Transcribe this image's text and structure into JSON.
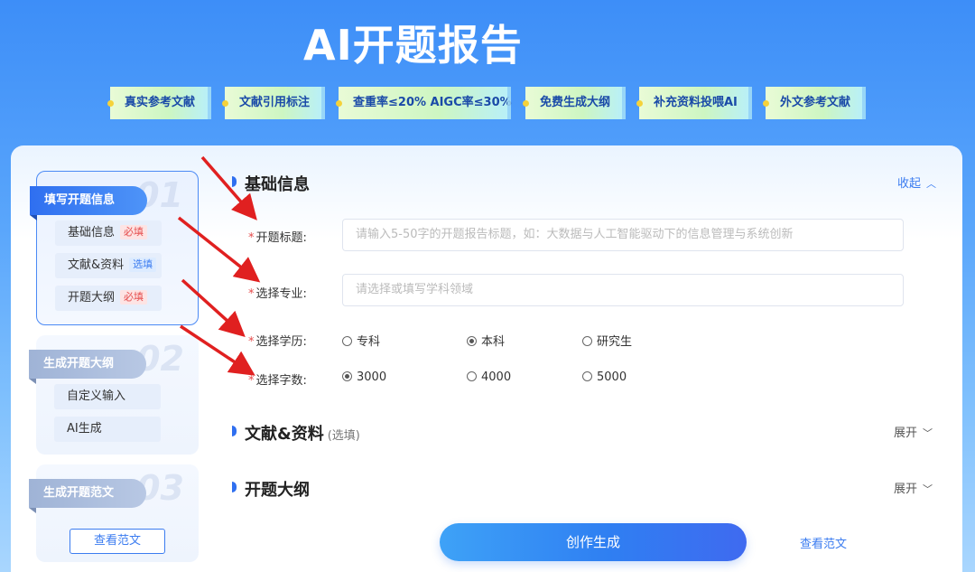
{
  "banner": {
    "title": "AI开题报告",
    "tags": [
      "真实参考文献",
      "文献引用标注",
      "查重率≤20%  AIGC率≤30%",
      "免费生成大纲",
      "补充资料投喂AI",
      "外文参考文献"
    ]
  },
  "sidebar": {
    "steps": [
      {
        "num": "01",
        "label": "填写开题信息",
        "items": [
          {
            "label": "基础信息",
            "tag": "必填"
          },
          {
            "label": "文献&资料",
            "tag": "选填"
          },
          {
            "label": "开题大纲",
            "tag": "必填"
          }
        ]
      },
      {
        "num": "02",
        "label": "生成开题大纲",
        "items": [
          {
            "label": "自定义输入"
          },
          {
            "label": "AI生成"
          }
        ]
      },
      {
        "num": "03",
        "label": "生成开题范文",
        "button": "查看范文"
      }
    ]
  },
  "basic": {
    "title": "基础信息",
    "toggle": "收起",
    "fields": {
      "topic": {
        "label": "开题标题:",
        "placeholder": "请输入5-50字的开题报告标题，如：大数据与人工智能驱动下的信息管理与系统创新"
      },
      "major": {
        "label": "选择专业:",
        "placeholder": "请选择或填写学科领域"
      },
      "degree": {
        "label": "选择学历:",
        "options": [
          "专科",
          "本科",
          "研究生"
        ],
        "selected": "本科"
      },
      "words": {
        "label": "选择字数:",
        "options": [
          "3000",
          "4000",
          "5000"
        ],
        "selected": "3000"
      }
    },
    "required_mark": "*"
  },
  "literature": {
    "title": "文献&资料",
    "sub": "(选填)",
    "toggle": "展开"
  },
  "outline": {
    "title": "开题大纲",
    "toggle": "展开"
  },
  "actions": {
    "create": "创作生成",
    "view_sample": "查看范文"
  },
  "colors": {
    "accent": "#2f6ff0",
    "required": "#e54b4b",
    "annotation_arrow": "#e02020"
  }
}
